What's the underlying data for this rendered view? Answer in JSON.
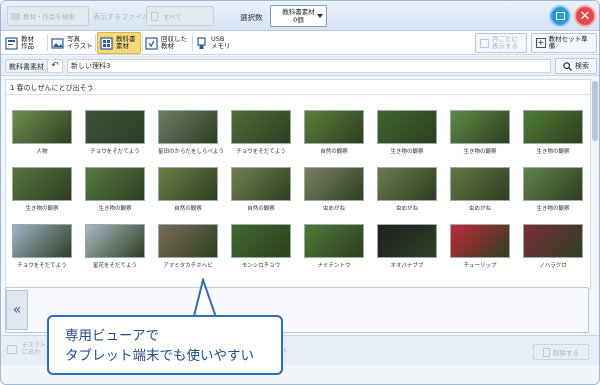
{
  "topbar": {
    "filter_label": "教材・作品を検索",
    "display_files_label": "表示するファイル",
    "display_files_value": "すべて",
    "selection_label": "選択数",
    "selection_value_line1": "教科書素材",
    "selection_value_line2": "0個"
  },
  "categories": [
    {
      "label1": "教材",
      "label2": "作品",
      "icon": "material-icon"
    },
    {
      "label1": "写真",
      "label2": "イラスト",
      "icon": "photo-icon"
    },
    {
      "label1": "教科書",
      "label2": "素材",
      "icon": "textbook-icon",
      "active": true
    },
    {
      "label1": "回収した",
      "label2": "教材",
      "icon": "collect-icon"
    },
    {
      "label1": "USB",
      "label2": "メモリ",
      "icon": "usb-icon"
    }
  ],
  "right_buttons": {
    "by_day_line1": "月ごとに",
    "by_day_line2": "表示する",
    "prepare_label": "教材セット準備"
  },
  "addrbar": {
    "crumb": "教科書素材",
    "path": "新しい理科3",
    "search_label": "検索"
  },
  "section": {
    "title": "1 春のしぜんにとび出そう"
  },
  "thumbnails_row1": [
    {
      "caption": "人物",
      "color": "#6f8f4e"
    },
    {
      "caption": "チョウをそだてよう",
      "color": "#40533a"
    },
    {
      "caption": "星田のからだをしらべよう",
      "color": "#6e7d62"
    },
    {
      "caption": "チョウをそだてよう",
      "color": "#4f6c3a"
    },
    {
      "caption": "自然の観察",
      "color": "#5a7f3a"
    },
    {
      "caption": "生き物の観察",
      "color": "#3e6630"
    },
    {
      "caption": "生き物の観察",
      "color": "#5d8a45"
    },
    {
      "caption": "生き物の観察",
      "color": "#4f7c34"
    }
  ],
  "thumbnails_row2": [
    {
      "caption": "生き物の観察",
      "color": "#55753e"
    },
    {
      "caption": "生き物の観察",
      "color": "#577b40"
    },
    {
      "caption": "自然の観察",
      "color": "#6b7f44"
    },
    {
      "caption": "自然の観察",
      "color": "#6e8151"
    },
    {
      "caption": "虫めがね",
      "color": "#7d8060"
    },
    {
      "caption": "虫めがね",
      "color": "#6a7b4e"
    },
    {
      "caption": "虫めがね",
      "color": "#62783f"
    },
    {
      "caption": "生き物の観察",
      "color": "#5f8448"
    }
  ],
  "thumbnails_row3": [
    {
      "caption": "チョウをそだてよう",
      "color": "#9fb3c8"
    },
    {
      "caption": "星花をそだてよう",
      "color": "#a8b9c6"
    },
    {
      "caption": "アマミタカチホヘビ",
      "color": "#7b6a55"
    },
    {
      "caption": "モンシロチョウ",
      "color": "#3f6a2e"
    },
    {
      "caption": "ナミテントウ",
      "color": "#4d7a34"
    },
    {
      "caption": "オオバナブブ",
      "color": "#1f1f1f"
    },
    {
      "caption": "チューリップ",
      "color": "#c0293a"
    },
    {
      "caption": "ノハラクロ",
      "color": "#7a2f3a"
    }
  ],
  "bottombar": {
    "left_line1": "デスクトップ",
    "left_line2": "に出力",
    "right_label": "削除する"
  },
  "callout": {
    "line1": "専用ビューアで",
    "line2": "タブレット端末でも使いやすい"
  }
}
